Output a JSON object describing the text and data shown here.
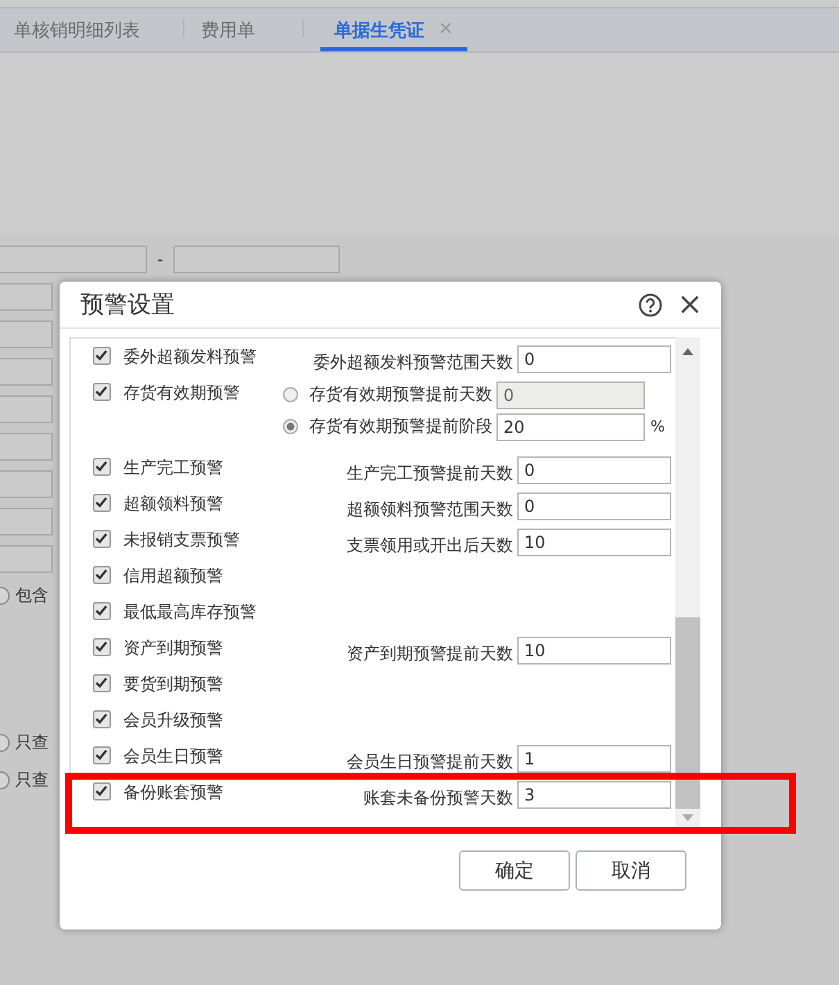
{
  "tabs": [
    {
      "label": "单核销明细列表",
      "selected": false
    },
    {
      "label": "费用单",
      "selected": false
    },
    {
      "label": "单据生凭证",
      "selected": true,
      "close_glyph": "✕"
    }
  ],
  "background_form": {
    "range_separator": "-",
    "checkboxes": [
      {
        "label": "包含",
        "checked": false
      },
      {
        "label": "只查",
        "checked": false
      },
      {
        "label": "只查",
        "checked": false
      }
    ]
  },
  "dialog": {
    "title": "预警设置",
    "items": [
      {
        "kind": "field",
        "label": "委外超额发料预警",
        "checked": true,
        "setting": {
          "label": "委外超额发料预警范围天数",
          "value": "0"
        }
      },
      {
        "kind": "radio-group",
        "label": "存货有效期预警",
        "checked": true,
        "options": [
          {
            "label": "存货有效期预警提前天数",
            "selected": false,
            "value": "0"
          },
          {
            "label": "存货有效期预警提前阶段",
            "selected": true,
            "value": "20",
            "unit": "%"
          }
        ]
      },
      {
        "kind": "field",
        "label": "生产完工预警",
        "checked": true,
        "setting": {
          "label": "生产完工预警提前天数",
          "value": "0"
        }
      },
      {
        "kind": "field",
        "label": "超额领料预警",
        "checked": true,
        "setting": {
          "label": "超额领料预警范围天数",
          "value": "0"
        }
      },
      {
        "kind": "field",
        "label": "未报销支票预警",
        "checked": true,
        "setting": {
          "label": "支票领用或开出后天数",
          "value": "10"
        }
      },
      {
        "kind": "plain",
        "label": "信用超额预警",
        "checked": true
      },
      {
        "kind": "plain",
        "label": "最低最高库存预警",
        "checked": true
      },
      {
        "kind": "field",
        "label": "资产到期预警",
        "checked": true,
        "setting": {
          "label": "资产到期预警提前天数",
          "value": "10"
        }
      },
      {
        "kind": "plain",
        "label": "要货到期预警",
        "checked": true
      },
      {
        "kind": "plain",
        "label": "会员升级预警",
        "checked": true
      },
      {
        "kind": "field",
        "label": "会员生日预警",
        "checked": true,
        "setting": {
          "label": "会员生日预警提前天数",
          "value": "1"
        }
      },
      {
        "kind": "field",
        "label": "备份账套预警",
        "checked": true,
        "setting": {
          "label": "账套未备份预警天数",
          "value": "3"
        }
      }
    ],
    "buttons": [
      "确定",
      "取消"
    ]
  }
}
